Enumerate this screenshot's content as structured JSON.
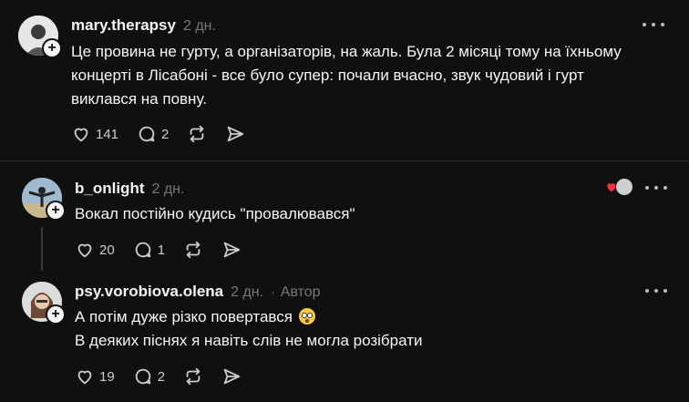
{
  "posts": [
    {
      "username": "mary.therapsy",
      "time": "2 дн.",
      "text_lines": [
        "Це провина не гурту, а організаторів, на жаль. Була 2 місяці тому на їхньому",
        "концерті в Лісабоні - все було супер: почали вчасно, звук чудовий і гурт",
        "виклався на повну."
      ],
      "likes": "141",
      "replies": "2"
    },
    {
      "username": "b_onlight",
      "time": "2 дн.",
      "text_lines": [
        "Вокал постійно кудись \"провалювався\""
      ],
      "likes": "20",
      "replies": "1"
    },
    {
      "username": "psy.vorobiova.olena",
      "time": "2 дн.",
      "author_label": "Автор",
      "text_lines": [
        "А потім дуже різко повертався",
        "В деяких піснях я навіть слів не могла розібрати"
      ],
      "likes": "19",
      "replies": "2"
    }
  ],
  "icons": {
    "like": "heart-icon",
    "reply": "comment-icon",
    "repost": "repost-icon",
    "share": "share-icon",
    "more": "more-icon",
    "follow": "plus-icon",
    "emoji": "flushed-face-emoji"
  },
  "colors": {
    "background": "#101010",
    "text": "#f3f5f7",
    "muted": "#777777",
    "liked_heart": "#ff3040"
  }
}
